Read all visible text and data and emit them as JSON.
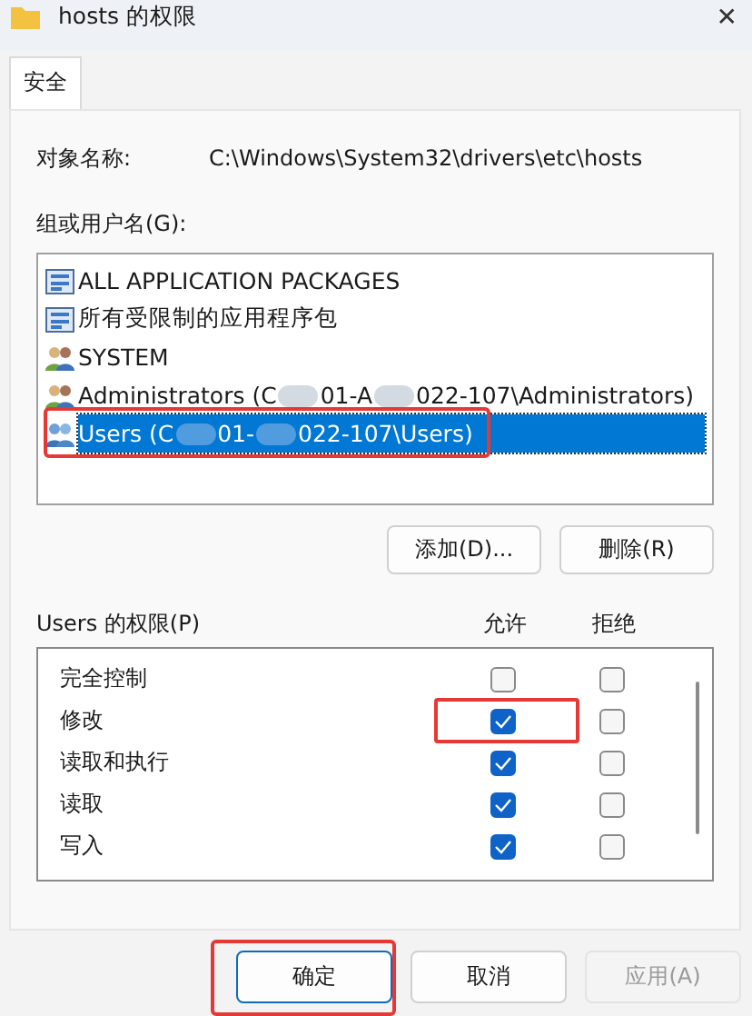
{
  "window": {
    "title": "hosts 的权限",
    "close": "✕"
  },
  "tabs": [
    {
      "label": "安全",
      "selected": true
    }
  ],
  "object": {
    "label": "对象名称:",
    "value": "C:\\Windows\\System32\\drivers\\etc\\hosts"
  },
  "users": {
    "label": "组或用户名(G):",
    "items": [
      {
        "kind": "package",
        "parts": [
          "ALL APPLICATION PACKAGES"
        ],
        "selected": false,
        "highlighted": false
      },
      {
        "kind": "package",
        "parts": [
          "所有受限制的应用程序包"
        ],
        "selected": false,
        "highlighted": false
      },
      {
        "kind": "user",
        "parts": [
          "SYSTEM"
        ],
        "selected": false,
        "highlighted": false
      },
      {
        "kind": "user",
        "parts": [
          "Administrators (C",
          "01-A",
          "022-107\\Administrators)"
        ],
        "selected": false,
        "highlighted": false
      },
      {
        "kind": "group",
        "parts": [
          "Users (C",
          "01-",
          "022-107\\Users)"
        ],
        "selected": true,
        "highlighted": true
      }
    ]
  },
  "user_buttons": [
    "添加(D)...",
    "删除(R)"
  ],
  "permissions": {
    "label": "Users 的权限(P)",
    "allow": "允许",
    "deny": "拒绝",
    "rows": [
      {
        "name": "完全控制",
        "allow": false,
        "deny": false,
        "highlighted": false
      },
      {
        "name": "修改",
        "allow": true,
        "deny": false,
        "highlighted": true
      },
      {
        "name": "读取和执行",
        "allow": true,
        "deny": false,
        "highlighted": false
      },
      {
        "name": "读取",
        "allow": true,
        "deny": false,
        "highlighted": false
      },
      {
        "name": "写入",
        "allow": true,
        "deny": false,
        "highlighted": false
      }
    ]
  },
  "buttons": [
    {
      "label": "确定",
      "disabled": false,
      "default": true,
      "highlighted": true
    },
    {
      "label": "取消",
      "disabled": false,
      "default": false,
      "highlighted": false
    },
    {
      "label": "应用(A)",
      "disabled": true,
      "default": false,
      "highlighted": false
    }
  ]
}
